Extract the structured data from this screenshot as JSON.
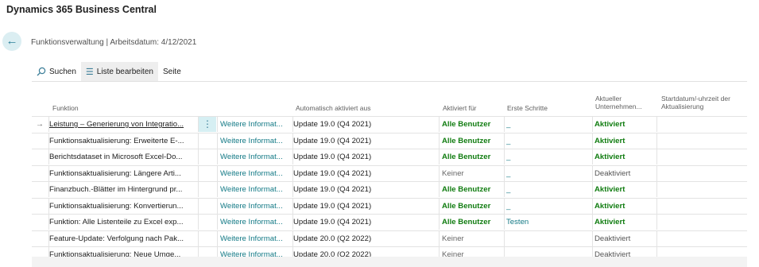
{
  "app": {
    "title": "Dynamics 365 Business Central"
  },
  "page": {
    "title": "Funktionsverwaltung | Arbeitsdatum: 4/12/2021"
  },
  "actions": {
    "search": "Suchen",
    "edit_list": "Liste bearbeiten",
    "page": "Seite"
  },
  "columns": {
    "funktion": "Funktion",
    "auto": "Automatisch aktiviert aus",
    "for": "Aktiviert für",
    "first": "Erste Schritte",
    "company_1": "Aktueller",
    "company_2": "Unternehmen...",
    "start_1": "Startdatum/-uhrzeit der",
    "start_2": "Aktualisierung"
  },
  "rows": [
    {
      "funktion": "Leistung – Generierung von Integratio...",
      "info": "Weitere Informat...",
      "update": "Update 19.0 (Q4 2021)",
      "for": "Alle Benutzer",
      "first": "_",
      "status": "Aktiviert",
      "active": true,
      "selected": true
    },
    {
      "funktion": "Funktionsaktualisierung: Erweiterte E-...",
      "info": "Weitere Informat...",
      "update": "Update 19.0 (Q4 2021)",
      "for": "Alle Benutzer",
      "first": "_",
      "status": "Aktiviert",
      "active": true
    },
    {
      "funktion": "Berichtsdataset in Microsoft Excel-Do...",
      "info": "Weitere Informat...",
      "update": "Update 19.0 (Q4 2021)",
      "for": "Alle Benutzer",
      "first": "_",
      "status": "Aktiviert",
      "active": true
    },
    {
      "funktion": "Funktionsaktualisierung: Längere Arti...",
      "info": "Weitere Informat...",
      "update": "Update 19.0 (Q4 2021)",
      "for": "Keiner",
      "first": "_",
      "status": "Deaktiviert",
      "active": false
    },
    {
      "funktion": "Finanzbuch.-Blätter im Hintergrund pr...",
      "info": "Weitere Informat...",
      "update": "Update 19.0 (Q4 2021)",
      "for": "Alle Benutzer",
      "first": "_",
      "status": "Aktiviert",
      "active": true
    },
    {
      "funktion": "Funktionsaktualisierung: Konvertierun...",
      "info": "Weitere Informat...",
      "update": "Update 19.0 (Q4 2021)",
      "for": "Alle Benutzer",
      "first": "_",
      "status": "Aktiviert",
      "active": true
    },
    {
      "funktion": "Funktion: Alle Listenteile zu Excel exp...",
      "info": "Weitere Informat...",
      "update": "Update 19.0 (Q4 2021)",
      "for": "Alle Benutzer",
      "first": "Testen",
      "status": "Aktiviert",
      "active": true
    },
    {
      "funktion": "Feature-Update: Verfolgung nach Pak...",
      "info": "Weitere Informat...",
      "update": "Update 20.0 (Q2 2022)",
      "for": "Keiner",
      "first": "",
      "status": "Deaktiviert",
      "active": false
    },
    {
      "funktion": "Funktionsaktualisierung: Neue Umge...",
      "info": "Weitere Informat...",
      "update": "Update 20.0 (Q2 2022)",
      "for": "Keiner",
      "first": "",
      "status": "Deaktiviert",
      "active": false
    }
  ],
  "icons": {
    "back": "arrow-left-icon",
    "search": "search-icon",
    "edit": "edit-list-icon",
    "row_menu": "vertical-ellipsis-icon",
    "row_arrow": "arrow-right-icon"
  },
  "colors": {
    "accent": "#147a86",
    "active_green": "#107c10",
    "back_bg": "#dbeef2"
  }
}
